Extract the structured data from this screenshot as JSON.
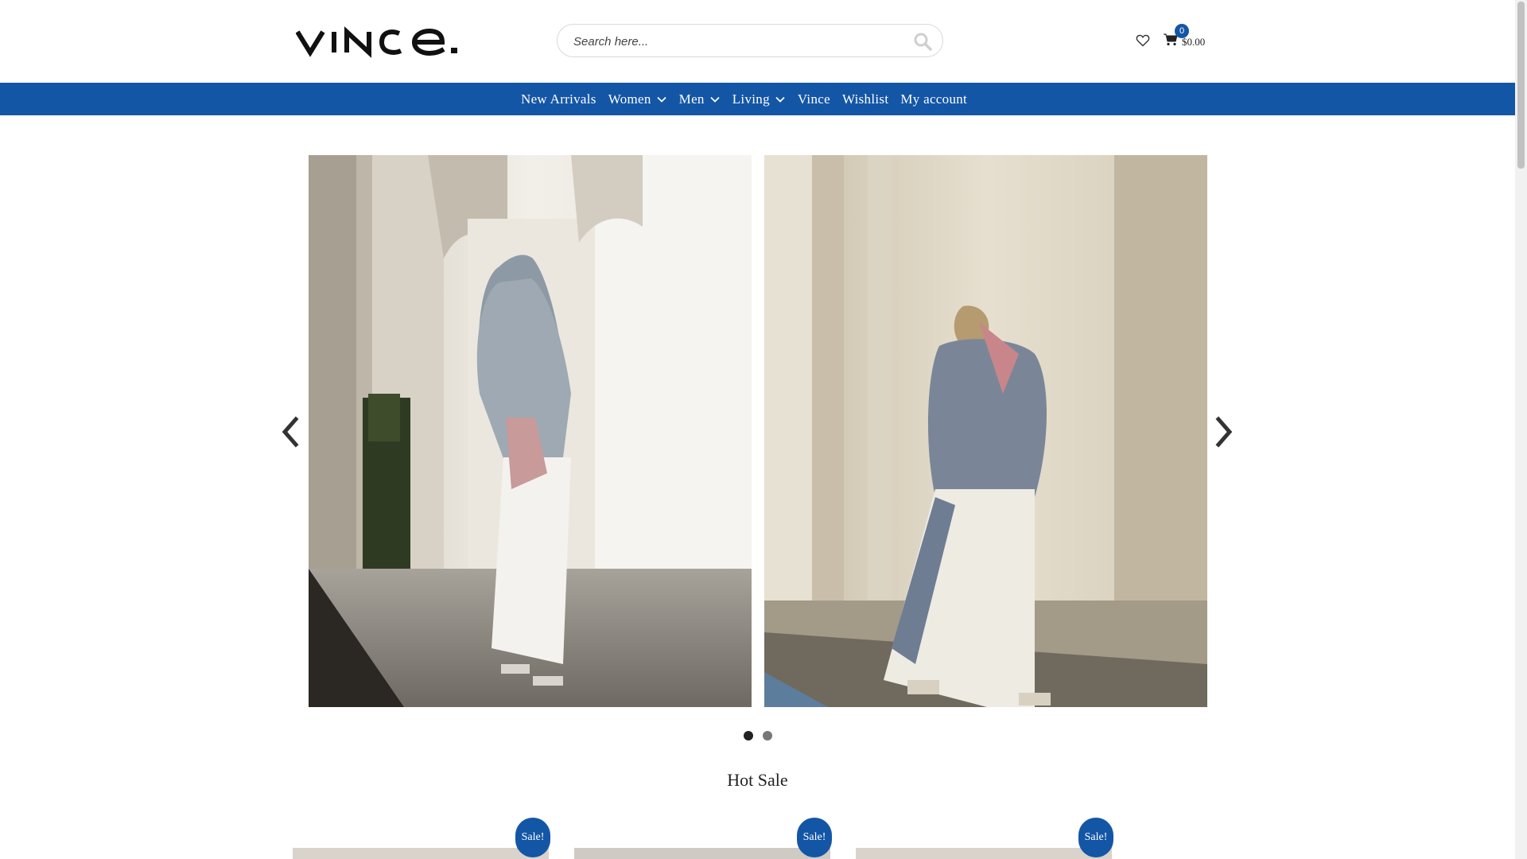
{
  "brand": {
    "logo_text": "vince."
  },
  "search": {
    "placeholder": "Search here..."
  },
  "cart": {
    "count": "0",
    "total": "$0.00"
  },
  "nav": {
    "items": [
      {
        "label": "New Arrivals",
        "dropdown": false
      },
      {
        "label": "Women",
        "dropdown": true
      },
      {
        "label": "Men",
        "dropdown": true
      },
      {
        "label": "Living",
        "dropdown": true
      },
      {
        "label": "Vince",
        "dropdown": false
      },
      {
        "label": "Wishlist",
        "dropdown": false
      },
      {
        "label": "My account",
        "dropdown": false
      }
    ]
  },
  "slider": {
    "slide_count": 2,
    "active_slide": 1
  },
  "hot_sale": {
    "title": "Hot Sale",
    "products": [
      {
        "badge": "Sale!"
      },
      {
        "badge": "Sale!"
      },
      {
        "badge": "Sale!"
      }
    ]
  },
  "colors": {
    "accent": "#1456a6",
    "header_bg": "#ffffff"
  }
}
